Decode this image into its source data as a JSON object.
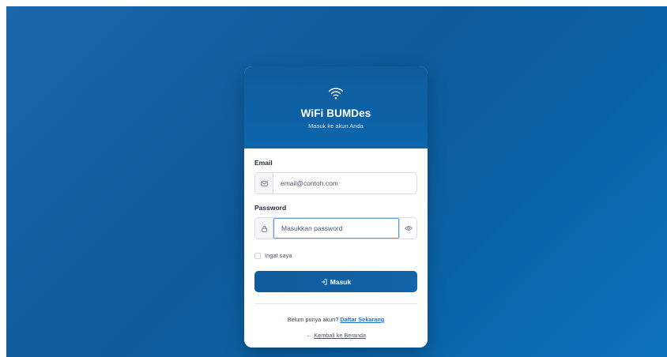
{
  "brand": {
    "title": "WiFi BUMDes",
    "subtitle": "Masuk ke akun Anda",
    "icon": "wifi-icon"
  },
  "form": {
    "email": {
      "label": "Email",
      "placeholder": "email@contoh.com",
      "value": "",
      "icon": "envelope-icon"
    },
    "password": {
      "label": "Password",
      "placeholder": "Masukkan password",
      "value": "",
      "icon": "lock-icon",
      "toggle_icon": "eye-icon"
    },
    "remember": {
      "label": "Ingat saya",
      "checked": false
    },
    "submit": {
      "label": "Masuk",
      "icon": "sign-in-icon"
    }
  },
  "footer": {
    "register_prompt": "Belum punya akun?",
    "register_link": "Daftar Sekarang",
    "back_arrow": "←",
    "back_link": "Kembali ke Beranda"
  },
  "colors": {
    "primary": "#0f5b9b",
    "link": "#1d6fd6",
    "focus_border": "#5b9bd5"
  }
}
